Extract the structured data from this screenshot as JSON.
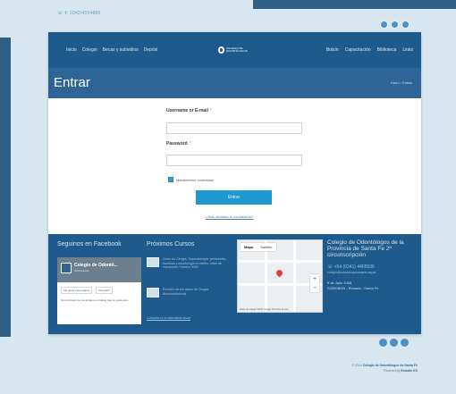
{
  "top": {
    "contact": "☏ ✆ 0342/4554889"
  },
  "nav": {
    "left": [
      "Inicio",
      "Colegio",
      "Becas y subsidios",
      "Depósi"
    ],
    "right": [
      "Bolsín",
      "Capacitación",
      "Biblioteca",
      "Links"
    ],
    "logo": "COLEGIO DE ODONTÓLOGOS"
  },
  "page": {
    "title": "Entrar",
    "breadcrumb": "Inicio › Entrar"
  },
  "form": {
    "username_label": "Username or E-mail",
    "password_label": "Password",
    "required_mark": "*",
    "remember_label": "Mantenerme conectado",
    "submit_label": "Entrar",
    "forgot_link": "¿Has olvidado tu contraseña?"
  },
  "footer": {
    "fb_title": "Seguinos en Facebook",
    "fb_page_name": "Colegio de Odontó...",
    "fb_page_sub": "Odontología",
    "fb_like": "Me gusta esta página",
    "fb_share": "Compartir",
    "fb_text": "Sé el primero de tus amigos en indicar que te gusta esto.",
    "courses_title": "Próximos Cursos",
    "courses": [
      "Curso de Cirugía: Traumatología, periodontia, fracturas y odontología en bebés. Inicio de inscripción: Febrero 2018",
      "Revisión de los casos de Cirugía Bucomaxilofacial"
    ],
    "courses_link": "Consulta en el calendario anual",
    "map_tabs": [
      "Mapa",
      "Satélite"
    ],
    "map_footer": "Datos de mapas ©2017 Google   Términos de uso",
    "contact_title": "Colegio de Odontólogos de la Provincia de Santa Fe 2ª circunscripción",
    "contact_phone": "☏ +54 (0341) 4405536",
    "contact_email": "colegio@odontologosrosario.org.ar",
    "contact_address_1": "9 de Julio 1066",
    "contact_address_2": "S2000BGN - Rosario - Santa Fe",
    "copyright_prefix": "© 2016",
    "copyright_org": "Colegio de Odontólogos de Santa Fe",
    "powered_prefix": "Powered by",
    "powered_by": "Estudio KS"
  },
  "colors": {
    "header": "#1f5a8c",
    "title_band": "#2e6596",
    "submit": "#1e98cf",
    "background": "#d7e6ef"
  }
}
